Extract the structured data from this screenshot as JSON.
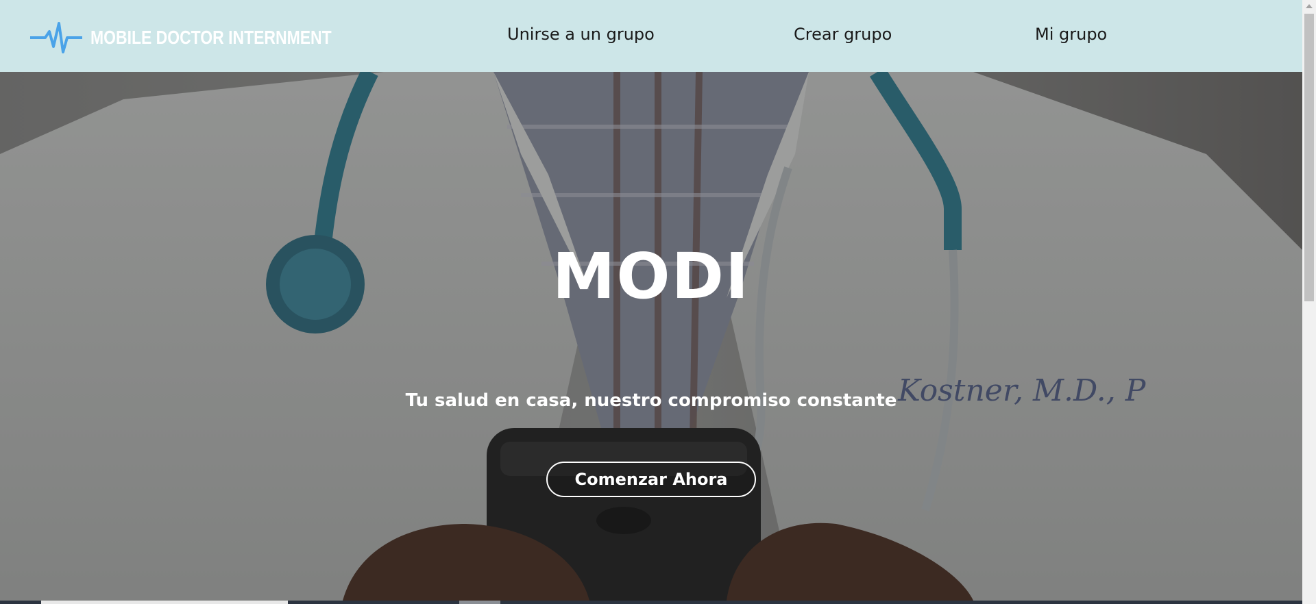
{
  "brand": {
    "name": "MOBILE DOCTOR INTERNMENT",
    "logo_icon": "heartbeat-icon",
    "logo_color": "#4aa3e8"
  },
  "nav": {
    "items": [
      {
        "label": "Unirse a un grupo"
      },
      {
        "label": "Crear grupo"
      },
      {
        "label": "Mi grupo"
      }
    ],
    "background": "#cde6e8"
  },
  "hero": {
    "title": "MODI",
    "subtitle": "Tu salud en casa, nuestro compromiso constante",
    "cta_label": "Comenzar Ahora",
    "image": "doctor-with-stethoscope-holding-phone"
  }
}
